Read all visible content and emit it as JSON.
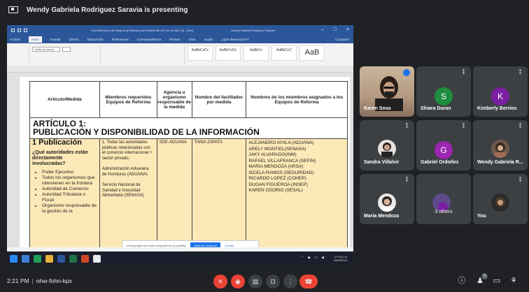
{
  "presenting": {
    "text": "Wendy Gabriela Rodriguez Saravia is presenting"
  },
  "word": {
    "window_title": "Guía Miembros de Equipos de Reforma por medida del AFC de la OMC (4) - Word",
    "user": "Wendy Gabriela Rodriguez Saravia",
    "tabs": [
      "Archivo",
      "Inicio",
      "Insertar",
      "Diseño",
      "Disposición",
      "Referencias",
      "Correspondencia",
      "Revisar",
      "Vista",
      "Ayuda",
      "¿Qué desea hacer?",
      "Compartir"
    ],
    "font_name": "Calibri (Cuerpo)",
    "styles": [
      "AaBbCcDc",
      "AaBbCcDc",
      "AaBbCc",
      "AaBbCcC",
      "AaB"
    ],
    "table": {
      "headers": [
        "Artículo/Medida",
        "Miembros requeridos Equipos de Reforma",
        "Agencia u organismo responsable de la medida",
        "Nombre del facilitador por medida",
        "Nombres de los miembros asignados a los Equipos de Reforma"
      ],
      "section_line1": "ARTÍCULO 1:",
      "section_line2": "PUBLICACIÓN Y DISPONIBILIDAD DE LA INFORMACIÓN",
      "measure_title": "1 Publicación",
      "question": "¿Qué autoridades están directamente involucradas?",
      "bullets": [
        "Poder Ejecutivo",
        "Todos los organismos que intervienen en la frontera",
        "Autoridad de Comercio",
        "Autoridad Tributaria o Fiscal",
        "Organismo responsable de la gestión de la"
      ],
      "required_members": [
        "1.     Todas las autoridades públicas relacionadas con el comercio internacional + sector privado.",
        "Administración Aduanera de Honduras (ADUANA)",
        "Servicio Nacional de Sanidad e Inocuidad Alimentaria (SENASA)"
      ],
      "agency": "SDE-ADUANA",
      "facilitator": "TANIA ZAPATA",
      "members": [
        "ALEJANDRO AYALA (ADUANA)",
        "ARELY MONTIEL(SENASA)",
        "JAKY ALVARADO(INM)",
        "RAFAEL VILLAFRANCA (SEFIN)",
        "MARIA MENDOZA (ARSA)",
        "ISCELA RAMOS (SEGURIDAD)",
        "RICARDO LOPEZ (COHEP)",
        "DUGAN FIGUEROA (INSEP)",
        "KAREN OSORIO (SESAL)"
      ]
    },
    "share_toast": {
      "message": "meet.google.com está compartiendo tu pantalla.",
      "stop_label": "Dejar de compartir",
      "hide_label": "Ocultar"
    },
    "taskbar_time": "07:16 p.m.",
    "taskbar_date": "09/05/2021"
  },
  "participants": [
    {
      "name": "Karen Sosa",
      "type": "video"
    },
    {
      "name": "Shiara Duran",
      "type": "avatar",
      "initial": "S",
      "color": "#1e8e3e"
    },
    {
      "name": "Kimberly Berrios",
      "type": "avatar",
      "initial": "K",
      "color": "#7b1fa2"
    },
    {
      "name": "Sandra Villalvir",
      "type": "photo"
    },
    {
      "name": "Gabriel Ordoñez",
      "type": "avatar",
      "initial": "G",
      "color": "#9c27b0"
    },
    {
      "name": "Wendy Gabriela R...",
      "type": "photo"
    },
    {
      "name": "Maria Mendoza",
      "type": "photo"
    },
    {
      "name": "3 others",
      "type": "group"
    },
    {
      "name": "You",
      "type": "photo"
    }
  ],
  "bottom_bar": {
    "time": "2:21 PM",
    "meeting_code": "ohw-fohn-kpx",
    "participant_count": "9"
  }
}
